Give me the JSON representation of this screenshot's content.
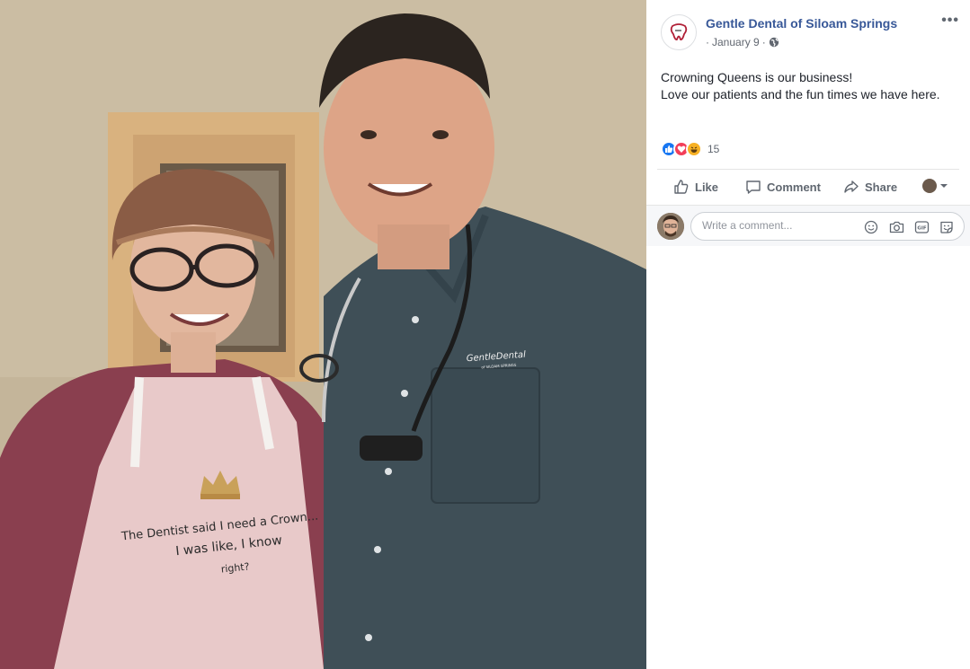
{
  "post": {
    "page_name": "Gentle Dental of Siloam Springs",
    "date": "January 9",
    "separator": "·",
    "more_label": "•••",
    "text_line_1": "Crowning Queens is our business!",
    "text_line_2": "Love our patients and the fun times we have here.",
    "reactions": [
      "like-reaction-icon",
      "love-reaction-icon",
      "haha-reaction-icon"
    ],
    "reaction_count": "15"
  },
  "actions": {
    "like": "Like",
    "comment": "Comment",
    "share": "Share"
  },
  "comment_box": {
    "placeholder": "Write a comment..."
  },
  "photo": {
    "apron_line_1": "The Dentist said I need a Crown...",
    "apron_line_2": "I was like, I know",
    "apron_line_3": "right?",
    "shirt_logo": "GentleDental",
    "shirt_logo_sub": "of SILOAM SPRINGS"
  },
  "colors": {
    "link_blue": "#385898",
    "like_blue": "#1877f2",
    "love_red": "#f33e58",
    "haha_yellow": "#f7b125",
    "shirt": "#3f4f57",
    "apron": "#e8c9c9"
  }
}
